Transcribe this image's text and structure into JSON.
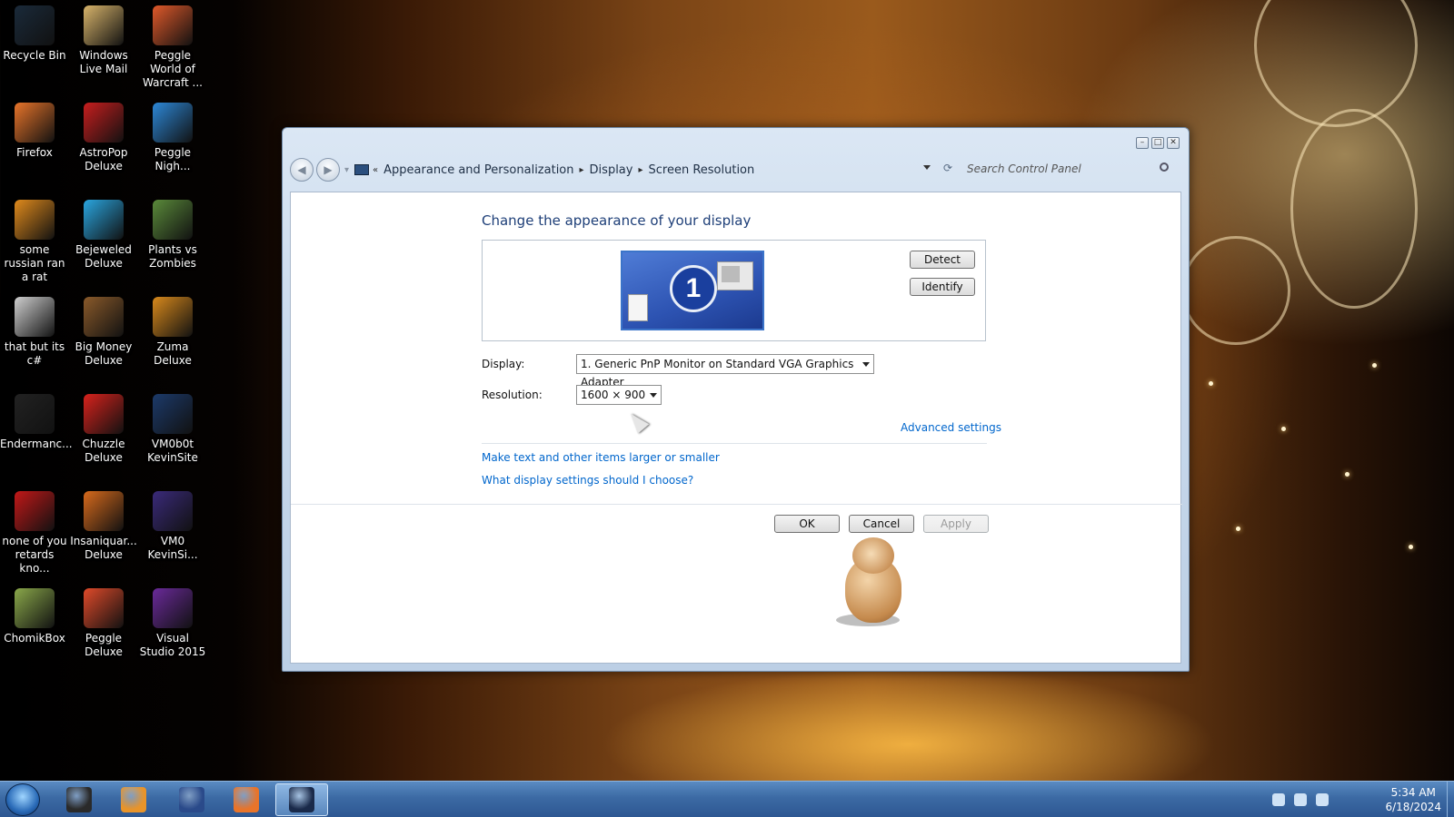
{
  "desktop": {
    "icons": [
      {
        "label": "Recycle Bin",
        "color": "#1a2a3a"
      },
      {
        "label": "Windows Live Mail",
        "color": "#d8b46a"
      },
      {
        "label": "Peggle World of Warcraft ...",
        "color": "#e0592a"
      },
      {
        "label": "Firefox",
        "color": "#e8742a"
      },
      {
        "label": "AstroPop Deluxe",
        "color": "#c81e1e"
      },
      {
        "label": "Peggle Nigh...",
        "color": "#2d88d8"
      },
      {
        "label": "some russian ran a rat",
        "color": "#e08a1c"
      },
      {
        "label": "Bejeweled Deluxe",
        "color": "#2aa6e0"
      },
      {
        "label": "Plants vs Zombies",
        "color": "#5a8a3a"
      },
      {
        "label": "that but its c#",
        "color": "#cfcfcf"
      },
      {
        "label": "Big Money Deluxe",
        "color": "#8a5a2a"
      },
      {
        "label": "Zuma Deluxe",
        "color": "#d8891c"
      },
      {
        "label": "Endermanc...",
        "color": "#222222"
      },
      {
        "label": "Chuzzle Deluxe",
        "color": "#d8221c"
      },
      {
        "label": "VM0b0t KevinSite",
        "color": "#1c3a6a"
      },
      {
        "label": "none of you retards kno...",
        "color": "#c21818"
      },
      {
        "label": "Insaniquar... Deluxe",
        "color": "#d86a1c"
      },
      {
        "label": "VM0 KevinSi...",
        "color": "#3a2a7a"
      },
      {
        "label": "ChomikBox",
        "color": "#8aa84a"
      },
      {
        "label": "Peggle Deluxe",
        "color": "#e04a2a"
      },
      {
        "label": "Visual Studio 2015",
        "color": "#6a2a9a"
      }
    ]
  },
  "window": {
    "breadcrumb": [
      "Appearance and Personalization",
      "Display",
      "Screen Resolution"
    ],
    "search_placeholder": "Search Control Panel",
    "heading": "Change the appearance of your display",
    "monitor_number": "1",
    "detect_label": "Detect",
    "identify_label": "Identify",
    "display_label": "Display:",
    "display_value": "1. Generic PnP Monitor on Standard VGA Graphics Adapter",
    "resolution_label": "Resolution:",
    "resolution_value": "1600 × 900",
    "advanced_link": "Advanced settings",
    "link_text_size": "Make text and other items larger or smaller",
    "link_what_settings": "What display settings should I choose?",
    "ok_label": "OK",
    "cancel_label": "Cancel",
    "apply_label": "Apply",
    "minimize_glyph": "–",
    "maximize_glyph": "□",
    "close_glyph": "✕",
    "back_glyph": "◀",
    "forward_glyph": "▶",
    "history_glyph": "▾",
    "breadcrumb_overflow": "«",
    "breadcrumb_separator": "▸",
    "refresh_glyph": "⟳"
  },
  "taskbar": {
    "items": [
      {
        "name": "explorer",
        "color": "#2a2a2a"
      },
      {
        "name": "media-player",
        "color": "#e8942a"
      },
      {
        "name": "globe-app",
        "color": "#2a4a8a"
      },
      {
        "name": "firefox",
        "color": "#e8742a"
      },
      {
        "name": "control-panel",
        "color": "#1a2a4a"
      }
    ],
    "time": "5:34 AM",
    "date": "6/18/2024"
  }
}
